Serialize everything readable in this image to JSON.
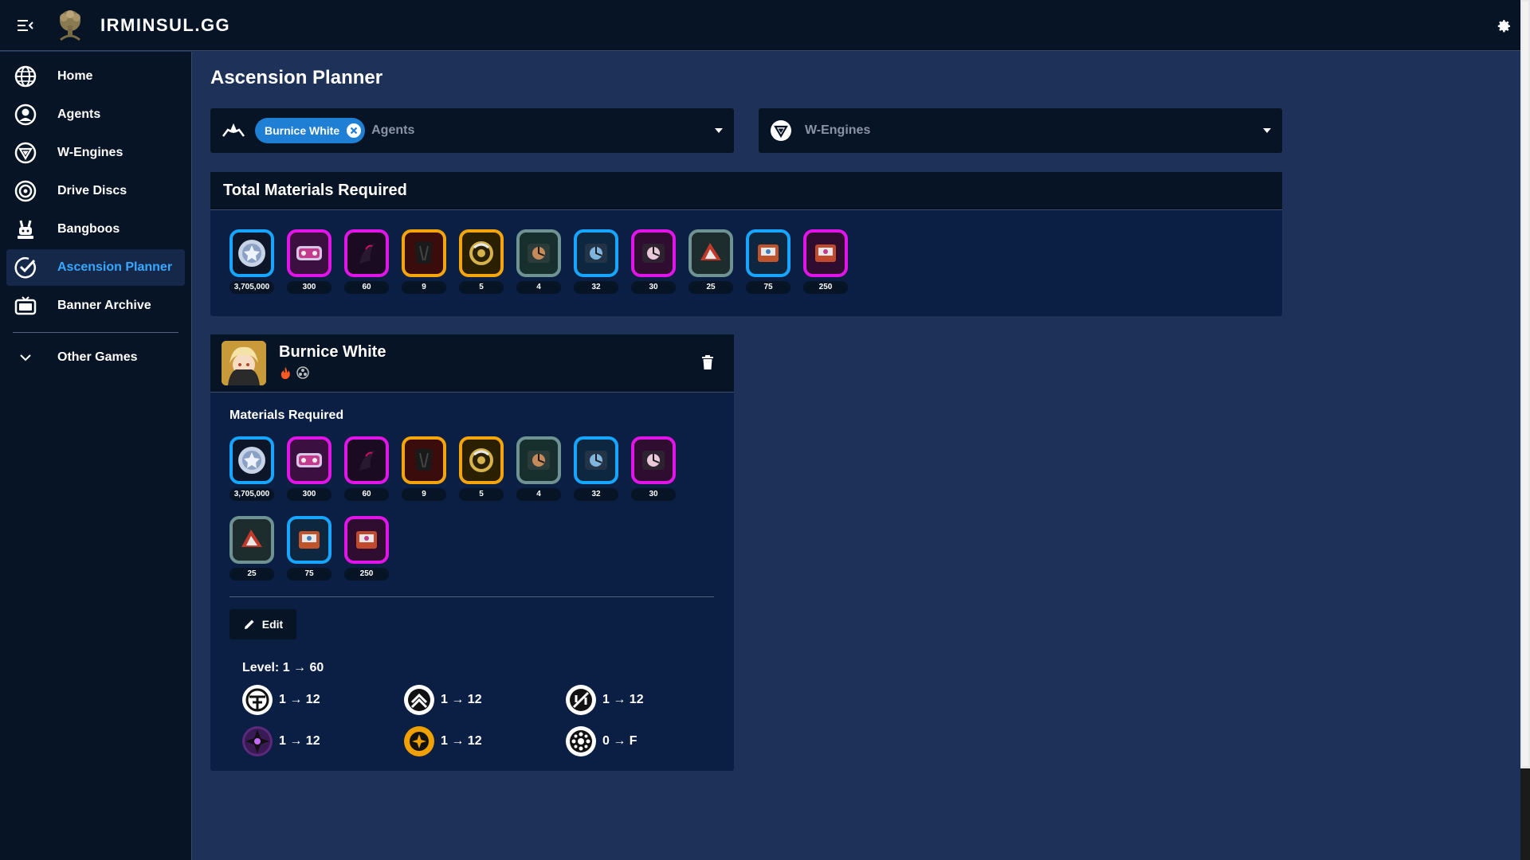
{
  "app": {
    "brand": "IRMINSUL.GG"
  },
  "sidebar": {
    "items": [
      {
        "label": "Home",
        "icon": "globe-icon"
      },
      {
        "label": "Agents",
        "icon": "agent-icon"
      },
      {
        "label": "W-Engines",
        "icon": "w-engine-icon"
      },
      {
        "label": "Drive Discs",
        "icon": "drive-disc-icon"
      },
      {
        "label": "Bangboos",
        "icon": "bangboo-icon"
      },
      {
        "label": "Ascension Planner",
        "icon": "check-icon",
        "active": true
      },
      {
        "label": "Banner Archive",
        "icon": "tv-icon"
      }
    ],
    "other_games": "Other Games"
  },
  "main": {
    "title": "Ascension Planner",
    "agents_select": {
      "chip": "Burnice White",
      "placeholder": "Agents"
    },
    "engines_select": {
      "placeholder": "W-Engines"
    },
    "total": {
      "title": "Total Materials Required",
      "items": [
        {
          "qty": "3,705,000",
          "border": "blue"
        },
        {
          "qty": "300",
          "border": "purple"
        },
        {
          "qty": "60",
          "border": "purple"
        },
        {
          "qty": "9",
          "border": "orange"
        },
        {
          "qty": "5",
          "border": "orange"
        },
        {
          "qty": "4",
          "border": "gray"
        },
        {
          "qty": "32",
          "border": "blue"
        },
        {
          "qty": "30",
          "border": "purple"
        },
        {
          "qty": "25",
          "border": "gray"
        },
        {
          "qty": "75",
          "border": "blue"
        },
        {
          "qty": "250",
          "border": "purple"
        }
      ]
    },
    "character": {
      "name": "Burnice White",
      "materials_title": "Materials Required",
      "edit_label": "Edit",
      "level": "Level: 1 → 60",
      "skills": [
        {
          "icon": "basic-attack-icon",
          "value": "1 → 12"
        },
        {
          "icon": "dodge-icon",
          "value": "1 → 12"
        },
        {
          "icon": "assist-icon",
          "value": "1 → 12"
        },
        {
          "icon": "special-attack-icon",
          "value": "1 → 12"
        },
        {
          "icon": "chain-attack-icon",
          "value": "1 → 12"
        },
        {
          "icon": "core-skill-icon",
          "value": "0 → F"
        }
      ]
    }
  },
  "colors": {
    "accent": "#38a8ff",
    "blue": "#17a6ff",
    "purple": "#e115e8",
    "orange": "#f4a50c",
    "gray": "#6f9393"
  }
}
